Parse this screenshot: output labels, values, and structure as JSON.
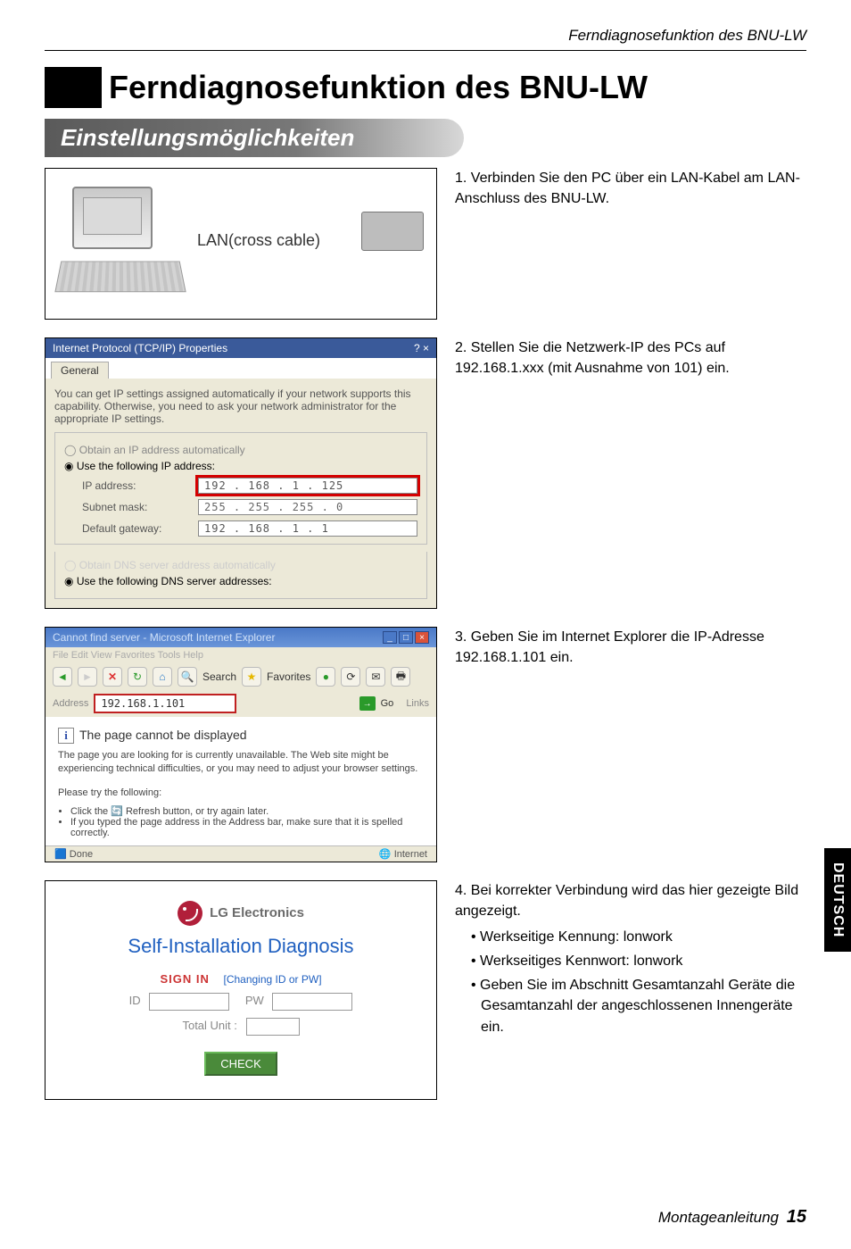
{
  "running_header": "Ferndiagnosefunktion des BNU-LW",
  "chapter_title": "Ferndiagnosefunktion des BNU-LW",
  "section_title": "Einstellungsmöglichkeiten",
  "fig1": {
    "lan_label": "LAN(cross cable)"
  },
  "step1": "1. Verbinden Sie den PC über ein LAN-Kabel am LAN-Anschluss des BNU-LW.",
  "fig2": {
    "title": "Internet Protocol (TCP/IP) Properties",
    "help": "?  ×",
    "tab": "General",
    "desc": "You can get IP settings assigned automatically if your network supports this capability. Otherwise, you need to ask your network administrator for the appropriate IP settings.",
    "opt_auto": "Obtain an IP address automatically",
    "opt_use": "Use the following IP address:",
    "lbl_ip": "IP address:",
    "val_ip": "192 . 168 . 1 . 125",
    "lbl_mask": "Subnet mask:",
    "val_mask": "255 . 255 . 255 .  0",
    "lbl_gw": "Default gateway:",
    "val_gw": "192 . 168 .  1  .  1",
    "dns_auto": "Obtain DNS server address automatically",
    "dns_use": "Use the following DNS server addresses:"
  },
  "step2": "2. Stellen Sie die Netzwerk-IP des PCs auf 192.168.1.xxx (mit Ausnahme von 101) ein.",
  "fig3": {
    "title": "Cannot find server - Microsoft Internet Explorer",
    "menu": "File   Edit   View   Favorites   Tools   Help",
    "search": "Search",
    "fav": "Favorites",
    "addr_lbl": "Address",
    "addr": "192.168.1.101",
    "go": "Go",
    "links": "Links",
    "h": "The page cannot be displayed",
    "p1": "The page you are looking for is currently unavailable. The Web site might be experiencing technical difficulties, or you may need to adjust your browser settings.",
    "p2": "Please try the following:",
    "b1": "Click the 🔄 Refresh button, or try again later.",
    "b2": "If you typed the page address in the Address bar, make sure that it is spelled correctly.",
    "done": "Done",
    "zone": "Internet"
  },
  "step3": "3. Geben Sie im Internet Explorer die IP-Adresse 192.168.1.101 ein.",
  "fig4": {
    "brand": "LG Electronics",
    "title": "Self-Installation Diagnosis",
    "signin": "SIGN IN",
    "chg": "[Changing ID or PW]",
    "id": "ID",
    "pw": "PW",
    "total": "Total Unit :",
    "check": "CHECK"
  },
  "step4": {
    "main": "4. Bei korrekter Verbindung wird das hier gezeigte Bild angezeigt.",
    "b1": "Werkseitige Kennung: lonwork",
    "b2": "Werkseitiges Kennwort: lonwork",
    "b3": "Geben Sie im Abschnitt Gesamtanzahl Geräte die Gesamtanzahl der angeschlossenen Innengeräte ein."
  },
  "side_tab": "DEUTSCH",
  "footer": {
    "label": "Montageanleitung",
    "page": "15"
  }
}
